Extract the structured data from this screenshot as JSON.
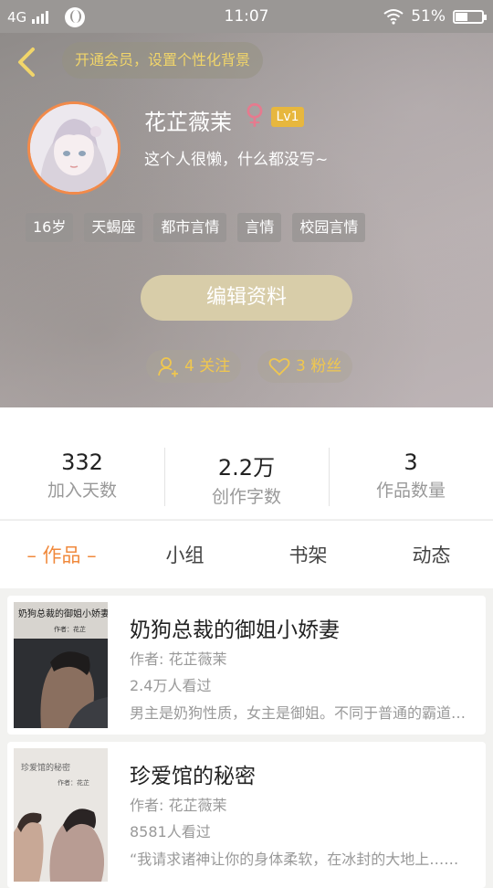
{
  "status_bar": {
    "network": "4G",
    "time": "11:07",
    "battery": "51%",
    "battery_level": 0.51
  },
  "profile": {
    "vip_banner": "开通会员，设置个性化背景",
    "name": "花芷薇茉",
    "gender_symbol": "♀",
    "level": "Lv1",
    "bio": "这个人很懒，什么都没写~",
    "tags": [
      "16岁",
      "天蝎座",
      "都市言情",
      "言情",
      "校园言情"
    ],
    "edit_button": "编辑资料",
    "follow_label": "4 关注",
    "fans_label": "3 粉丝"
  },
  "stats": [
    {
      "value": "332",
      "label": "加入天数"
    },
    {
      "value": "2.2万",
      "label": "创作字数"
    },
    {
      "value": "3",
      "label": "作品数量"
    }
  ],
  "tabs": [
    {
      "label": "– 作品 –",
      "active": true
    },
    {
      "label": "小组",
      "active": false
    },
    {
      "label": "书架",
      "active": false
    },
    {
      "label": "动态",
      "active": false
    }
  ],
  "works": [
    {
      "title": "奶狗总裁的御姐小娇妻",
      "author": "作者: 花芷薇茉",
      "views": "2.4万人看过",
      "description": "男主是奶狗性质，女主是御姐。不同于普通的霸道总裁文……",
      "cover_text": "奶狗总裁的御姐小娇妻",
      "cover_author": "作者：花芷"
    },
    {
      "title": "珍爱馆的秘密",
      "author": "作者: 花芷薇茉",
      "views": "8581人看过",
      "description": "“我请求诸神让你的身体柔软，在冰封的大地上……",
      "cover_text": "珍爱馆的秘密",
      "cover_author": "作者：花芷"
    }
  ],
  "colors": {
    "accent": "#f0893c",
    "gold": "#f0c74f",
    "level_badge": "#e7b73e",
    "edit_button": "#d8cda9"
  }
}
